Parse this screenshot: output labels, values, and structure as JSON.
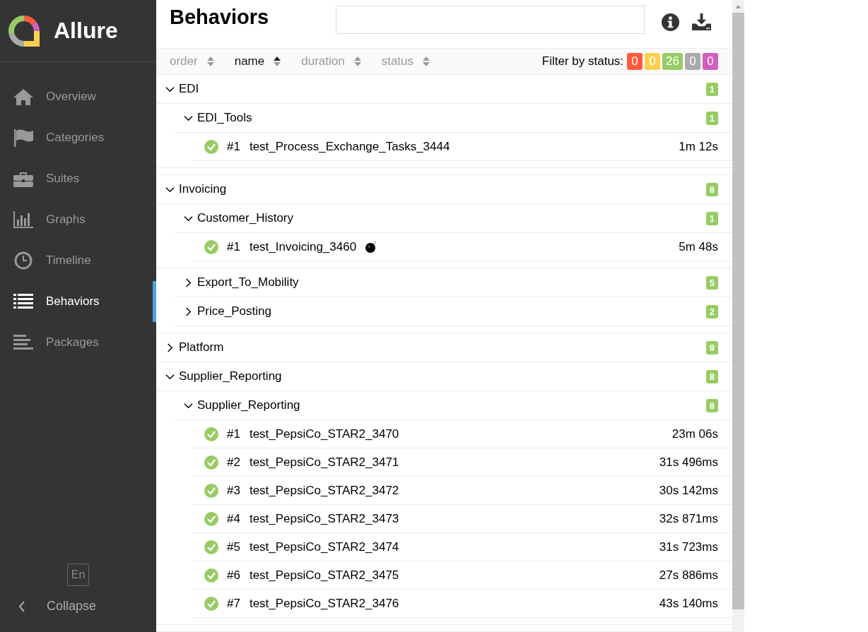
{
  "sidebar": {
    "brand": "Allure",
    "items": [
      {
        "label": "Overview",
        "selected": false
      },
      {
        "label": "Categories",
        "selected": false
      },
      {
        "label": "Suites",
        "selected": false
      },
      {
        "label": "Graphs",
        "selected": false
      },
      {
        "label": "Timeline",
        "selected": false
      },
      {
        "label": "Behaviors",
        "selected": true
      },
      {
        "label": "Packages",
        "selected": false
      }
    ],
    "language": "En",
    "collapse": "Collapse"
  },
  "page": {
    "title": "Behaviors"
  },
  "sorters": [
    {
      "label": "order",
      "selected": false
    },
    {
      "label": "name",
      "selected": true
    },
    {
      "label": "duration",
      "selected": false
    },
    {
      "label": "status",
      "selected": false
    }
  ],
  "filter": {
    "label": "Filter by status:",
    "statuses": [
      {
        "count": "0",
        "color": "#fd5a3e"
      },
      {
        "count": "0",
        "color": "#ffd050"
      },
      {
        "count": "26",
        "color": "#97cc64"
      },
      {
        "count": "0",
        "color": "#aaaaaa"
      },
      {
        "count": "0",
        "color": "#d35ebe"
      }
    ]
  },
  "tree": [
    {
      "kind": "group",
      "name": "EDI",
      "count": "1",
      "expanded": true,
      "children": [
        {
          "kind": "group",
          "name": "EDI_Tools",
          "count": "1",
          "expanded": true,
          "children": [
            {
              "kind": "test",
              "number": "#1",
              "name": "test_Process_Exchange_Tasks_3444",
              "duration": "1m 12s",
              "passed": true,
              "flaky": false
            }
          ]
        }
      ]
    },
    {
      "kind": "group",
      "name": "Invoicing",
      "count": "8",
      "expanded": true,
      "children": [
        {
          "kind": "group",
          "name": "Customer_History",
          "count": "1",
          "expanded": true,
          "children": [
            {
              "kind": "test",
              "number": "#1",
              "name": "test_Invoicing_3460",
              "duration": "5m 48s",
              "passed": true,
              "flaky": true
            }
          ]
        },
        {
          "kind": "group",
          "name": "Export_To_Mobility",
          "count": "5",
          "expanded": false
        },
        {
          "kind": "group",
          "name": "Price_Posting",
          "count": "2",
          "expanded": false
        }
      ]
    },
    {
      "kind": "group",
      "name": "Platform",
      "count": "9",
      "expanded": false
    },
    {
      "kind": "group",
      "name": "Supplier_Reporting",
      "count": "8",
      "expanded": true,
      "children": [
        {
          "kind": "group",
          "name": "Supplier_Reporting",
          "count": "8",
          "expanded": true,
          "children": [
            {
              "kind": "test",
              "number": "#1",
              "name": "test_PepsiCo_STAR2_3470",
              "duration": "23m 06s",
              "passed": true,
              "flaky": false
            },
            {
              "kind": "test",
              "number": "#2",
              "name": "test_PepsiCo_STAR2_3471",
              "duration": "31s 496ms",
              "passed": true,
              "flaky": false
            },
            {
              "kind": "test",
              "number": "#3",
              "name": "test_PepsiCo_STAR2_3472",
              "duration": "30s 142ms",
              "passed": true,
              "flaky": false
            },
            {
              "kind": "test",
              "number": "#4",
              "name": "test_PepsiCo_STAR2_3473",
              "duration": "32s 871ms",
              "passed": true,
              "flaky": false
            },
            {
              "kind": "test",
              "number": "#5",
              "name": "test_PepsiCo_STAR2_3474",
              "duration": "31s 723ms",
              "passed": true,
              "flaky": false
            },
            {
              "kind": "test",
              "number": "#6",
              "name": "test_PepsiCo_STAR2_3475",
              "duration": "27s 886ms",
              "passed": true,
              "flaky": false
            },
            {
              "kind": "test",
              "number": "#7",
              "name": "test_PepsiCo_STAR2_3476",
              "duration": "43s 140ms",
              "passed": true,
              "flaky": false
            }
          ]
        }
      ]
    }
  ]
}
